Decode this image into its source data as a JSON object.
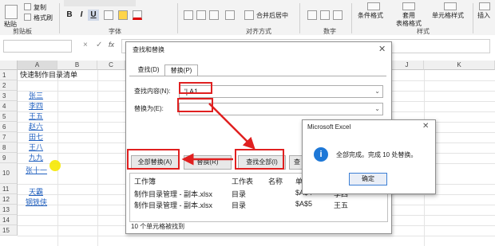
{
  "ribbon": {
    "paste": "粘贴",
    "copy": "复制",
    "format_painter": "格式刷",
    "clipboard_group": "剪贴板",
    "font_group": "字体",
    "align_group": "对齐方式",
    "number_group": "数字",
    "style_group": "样式",
    "merge_center": "合并后居中",
    "conditional_format": "条件格式",
    "table_format_1": "套用",
    "table_format_2": "表格格式",
    "cell_style": "单元格样式",
    "insert": "插入",
    "bold": "B",
    "italic": "I",
    "underline": "U"
  },
  "formula_bar": {
    "cancel": "×",
    "confirm": "✓",
    "fx": "fx"
  },
  "sheet": {
    "columns": [
      "A",
      "B",
      "C",
      "J",
      "K"
    ],
    "rows": [
      "1",
      "2",
      "3",
      "4",
      "5",
      "6",
      "7",
      "8",
      "9",
      "10",
      "11",
      "12",
      "13",
      "14",
      "15"
    ],
    "a1": "快速制作目录清单",
    "names": [
      "张三",
      "李四",
      "王五",
      "赵六",
      "田七",
      "王八",
      "九九",
      "张十一"
    ],
    "names2": [
      "天霸",
      "钢铁侠"
    ]
  },
  "dialog": {
    "title": "查找和替换",
    "tab_find": "查找(D)",
    "tab_replace": "替换(P)",
    "find_label": "查找内容(N):",
    "find_value": "'| A1",
    "replace_label": "替换为(E):",
    "replace_value": "",
    "btn_replace_all": "全部替换(A)",
    "btn_replace": "替换(R)",
    "btn_find_all": "查找全部(I)",
    "btn_find_next": "查",
    "col_workbook": "工作簿",
    "col_sheet": "工作表",
    "col_name": "名称",
    "col_cell": "单",
    "rows": [
      {
        "workbook": "制作目录管理 - 副本.xlsx",
        "sheet": "目录",
        "cell": "$A$4",
        "value": "李四"
      },
      {
        "workbook": "制作目录管理 - 副本.xlsx",
        "sheet": "目录",
        "cell": "$A$5",
        "value": "王五"
      }
    ],
    "status": "10 个单元格被找到"
  },
  "msgbox": {
    "title": "Microsoft Excel",
    "message": "全部完成。完成 10 处替换。",
    "ok": "确定"
  },
  "colors": {
    "accent_red": "#e02020",
    "link_blue": "#1f5fbf",
    "info_blue": "#1e78d7"
  }
}
